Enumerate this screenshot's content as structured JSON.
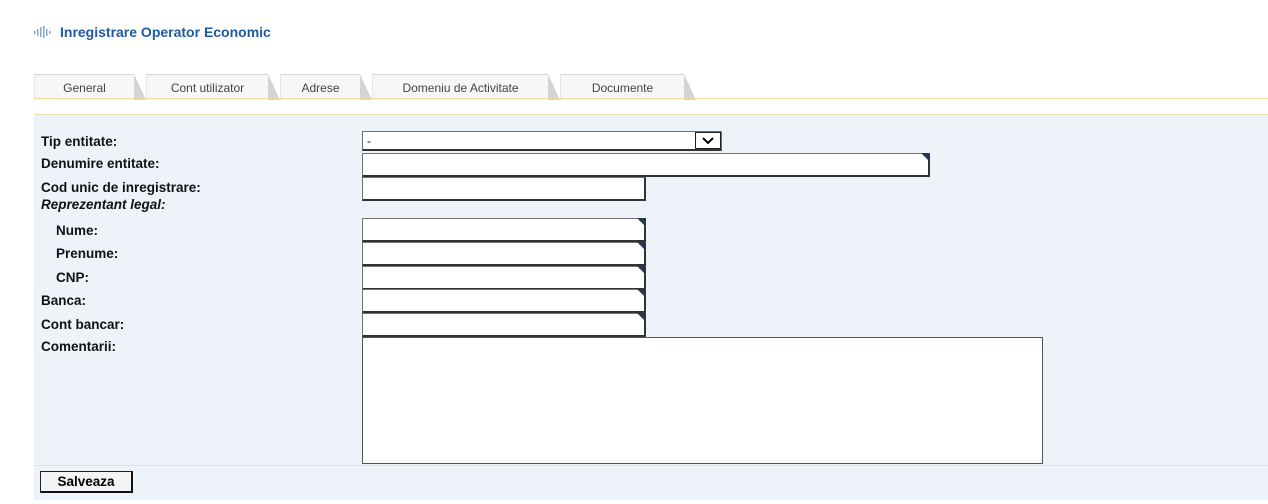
{
  "header": {
    "title": "Inregistrare Operator Economic",
    "icon": "equalizer-icon"
  },
  "tabs": [
    {
      "label": "General"
    },
    {
      "label": "Cont utilizator"
    },
    {
      "label": "Adrese"
    },
    {
      "label": "Domeniu de Activitate"
    },
    {
      "label": "Documente"
    }
  ],
  "form": {
    "tip_entitate": {
      "label": "Tip entitate:",
      "value": "-"
    },
    "denumire_entitate": {
      "label": "Denumire entitate:",
      "value": ""
    },
    "cod_unic": {
      "label": "Cod unic de inregistrare:",
      "value": ""
    },
    "reprezentant_legal": {
      "label": "Reprezentant legal:"
    },
    "nume": {
      "label": "Nume:",
      "value": ""
    },
    "prenume": {
      "label": "Prenume:",
      "value": ""
    },
    "cnp": {
      "label": "CNP:",
      "value": ""
    },
    "banca": {
      "label": "Banca:",
      "value": ""
    },
    "cont_bancar": {
      "label": "Cont bancar:",
      "value": ""
    },
    "comentarii": {
      "label": "Comentarii:",
      "value": ""
    }
  },
  "actions": {
    "save_label": "Salveaza"
  },
  "colors": {
    "accent": "#1f5aa0",
    "panel_bg": "#edf3f9",
    "border": "#f4dfb4"
  }
}
